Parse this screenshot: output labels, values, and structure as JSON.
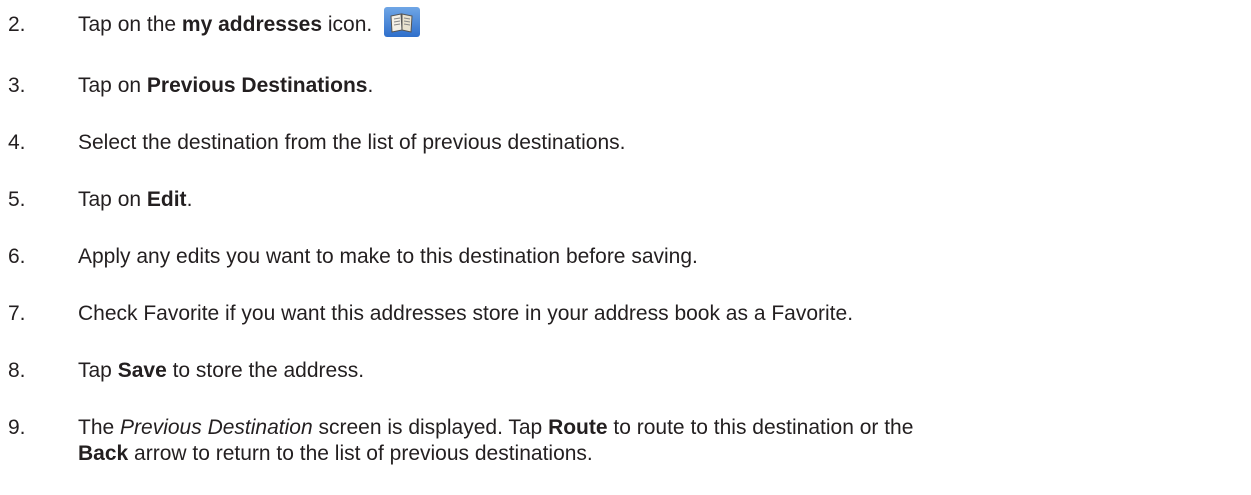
{
  "steps": [
    {
      "num": "2.",
      "pre": "Tap on the ",
      "bold": "my addresses",
      "post": " icon.",
      "icon": "address-book-icon"
    },
    {
      "num": "3.",
      "pre": "Tap on ",
      "bold": "Previous Destinations",
      "post": "."
    },
    {
      "num": "4.",
      "text": "Select the destination from the list of previous destinations."
    },
    {
      "num": "5.",
      "pre": "Tap on ",
      "bold": "Edit",
      "post": "."
    },
    {
      "num": "6.",
      "text": "Apply any edits you want to make to this destination before saving."
    },
    {
      "num": "7.",
      "text": "Check Favorite if you want this addresses store in your address book as a Favorite."
    },
    {
      "num": "8.",
      "pre": "Tap ",
      "bold": "Save",
      "post": " to store the address."
    },
    {
      "num": "9.",
      "pre": "The ",
      "italic": "Previous Destination",
      "mid": " screen is displayed.  Tap ",
      "bold": "Route",
      "post": " to route to this destination or the",
      "bold2": "Back",
      "post2": " arrow to return to the list of previous destinations."
    }
  ]
}
